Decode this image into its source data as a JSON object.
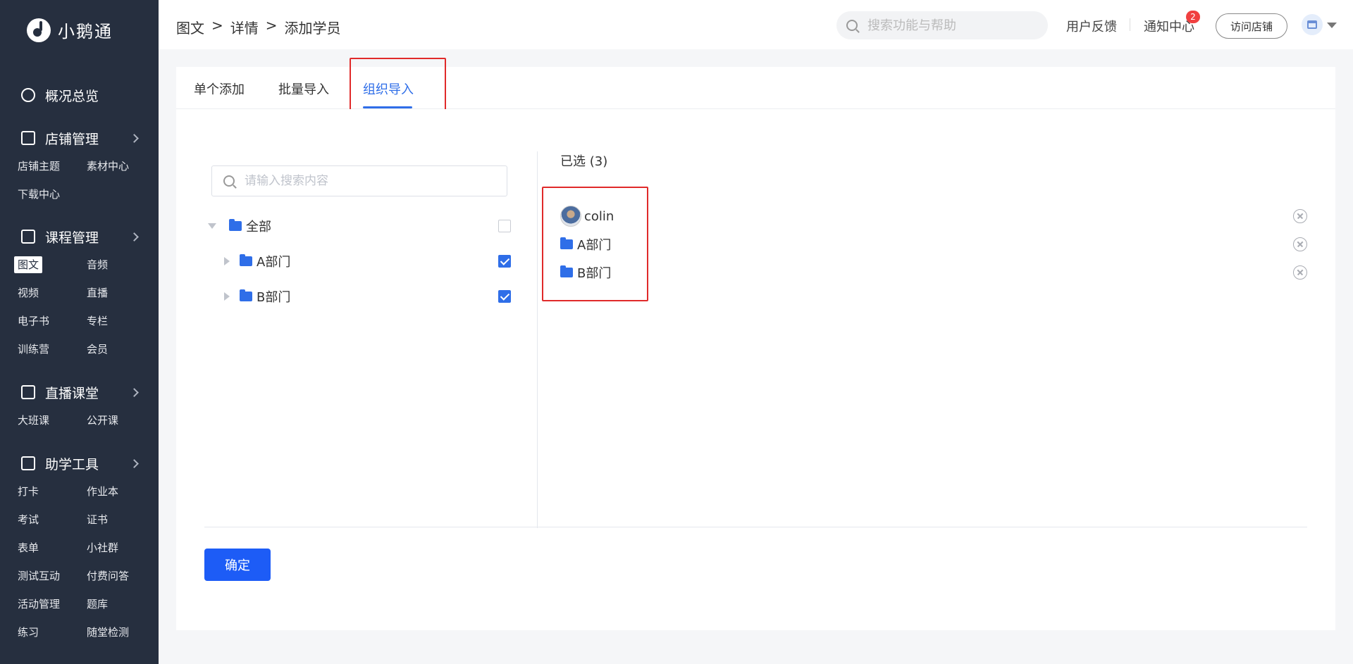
{
  "app": {
    "logo_text": "小鹅通"
  },
  "sidebar": {
    "groups": [
      {
        "label": "概况总览",
        "items": []
      },
      {
        "label": "店铺管理",
        "items": [
          "店铺主题",
          "素材中心",
          "下载中心"
        ]
      },
      {
        "label": "课程管理",
        "items": [
          "图文",
          "音频",
          "视频",
          "直播",
          "电子书",
          "专栏",
          "训练营",
          "会员"
        ]
      },
      {
        "label": "直播课堂",
        "items": [
          "大班课",
          "公开课"
        ]
      },
      {
        "label": "助学工具",
        "items": [
          "打卡",
          "作业本",
          "考试",
          "证书",
          "表单",
          "小社群",
          "测试互动",
          "付费问答",
          "活动管理",
          "题库",
          "练习",
          "随堂检测"
        ]
      }
    ],
    "active_item": "图文"
  },
  "header": {
    "breadcrumb": [
      "图文",
      ">",
      "详情",
      ">",
      "添加学员"
    ],
    "search_placeholder": "搜索功能与帮助",
    "feedback": "用户反馈",
    "notifications": "通知中心",
    "notification_count": "2",
    "visit_store": "访问店铺"
  },
  "tabs": [
    {
      "label": "单个添加",
      "active": false
    },
    {
      "label": "批量导入",
      "active": false
    },
    {
      "label": "组织导入",
      "active": true
    }
  ],
  "tree": {
    "search_placeholder": "请输入搜索内容",
    "nodes": [
      {
        "label": "全部",
        "expanded": true,
        "checked": false
      },
      {
        "label": "A部门",
        "expanded": false,
        "checked": true
      },
      {
        "label": "B部门",
        "expanded": false,
        "checked": true
      }
    ]
  },
  "selected": {
    "title": "已选 (3)",
    "items": [
      {
        "label": "colin",
        "type": "user"
      },
      {
        "label": "A部门",
        "type": "folder"
      },
      {
        "label": "B部门",
        "type": "folder"
      }
    ]
  },
  "confirm_label": "确定",
  "colors": {
    "accent": "#2f6ee8",
    "button": "#1d5cf6",
    "sidebar": "#262f3f",
    "highlight": "#e02a2a"
  }
}
